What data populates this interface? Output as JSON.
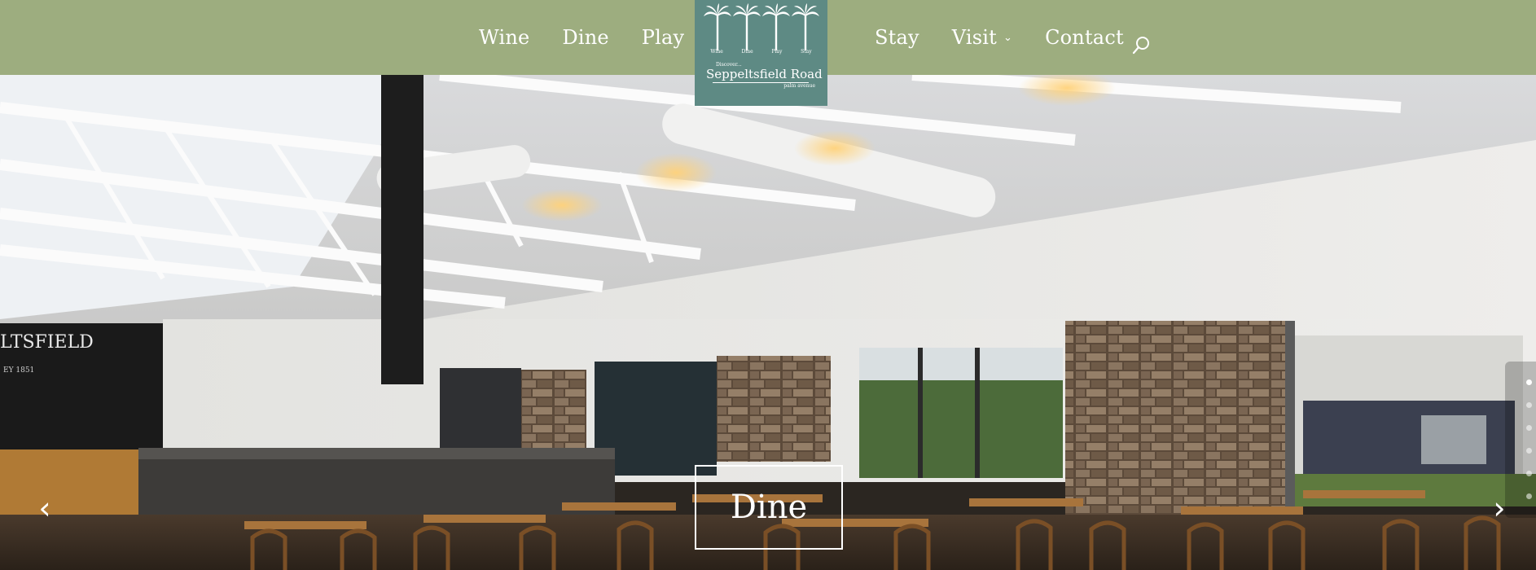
{
  "nav": {
    "left": [
      "Wine",
      "Dine",
      "Play"
    ],
    "right": [
      "Stay",
      "Visit",
      "Contact"
    ]
  },
  "logo": {
    "categories": [
      "Wine",
      "Dine",
      "Play",
      "Stay"
    ],
    "discover": "Discover...",
    "name": "Seppeltsfield Road",
    "tagline": "palm avenue"
  },
  "hero": {
    "slide_title": "Dine",
    "wall_sign": "LTSFIELD",
    "wall_sign_year": "EY 1851",
    "slide_count": 6,
    "active_slide": 1
  },
  "icons": {
    "search": "search-icon",
    "prev": "chevron-left-icon",
    "next": "chevron-right-icon",
    "visit_dropdown": "chevron-down-icon"
  },
  "colors": {
    "header_bg": "#9dad7f",
    "logo_bg": "#5e8a84",
    "text": "#ffffff"
  }
}
